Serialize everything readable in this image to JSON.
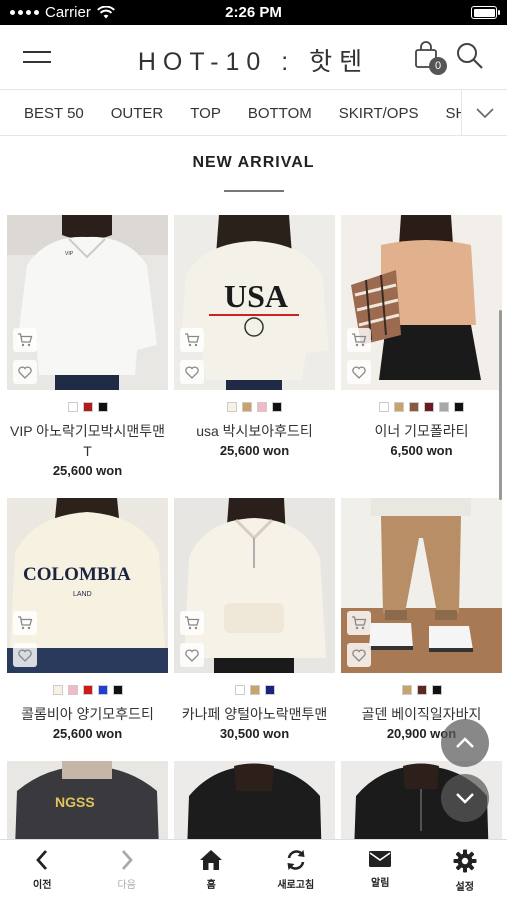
{
  "status_bar": {
    "carrier": "Carrier",
    "time": "2:26 PM"
  },
  "header": {
    "logo": "HOT-10 : 핫텐",
    "cart_count": "0"
  },
  "categories": [
    "BEST 50",
    "OUTER",
    "TOP",
    "BOTTOM",
    "SKIRT/OPS",
    "SHO"
  ],
  "section": {
    "title": "NEW ARRIVAL"
  },
  "products": [
    {
      "name": "VIP 아노락기모박시맨투맨T",
      "price": "25,600 won",
      "colors": [
        "#ffffff",
        "#b01c1c",
        "#111111"
      ]
    },
    {
      "name": "usa 박시보아후드티",
      "price": "25,600 won",
      "colors": [
        "#f7f2e3",
        "#c9a46a",
        "#f2b8c6",
        "#111111"
      ]
    },
    {
      "name": "이너 기모폴라티",
      "price": "6,500 won",
      "colors": [
        "#ffffff",
        "#c9a46a",
        "#8b5a3c",
        "#6a1a22",
        "#a8a8a8",
        "#111111"
      ]
    },
    {
      "name": "콜롬비아 양기모후드티",
      "price": "25,600 won",
      "colors": [
        "#f7f2e3",
        "#f2b8c6",
        "#cc1b1b",
        "#1f3fd0",
        "#111111"
      ]
    },
    {
      "name": "카나페 양털아노락맨투맨",
      "price": "30,500 won",
      "colors": [
        "#ffffff",
        "#c9a46a",
        "#1a237e"
      ]
    },
    {
      "name": "골덴 베이직일자바지",
      "price": "20,900 won",
      "colors": [
        "#c9a46a",
        "#5b2a1e",
        "#111111"
      ]
    }
  ],
  "bottom_nav": [
    {
      "label": "이전",
      "icon": "back-icon"
    },
    {
      "label": "다음",
      "icon": "forward-icon"
    },
    {
      "label": "홈",
      "icon": "home-icon"
    },
    {
      "label": "새로고침",
      "icon": "refresh-icon"
    },
    {
      "label": "알림",
      "icon": "mail-icon"
    },
    {
      "label": "설정",
      "icon": "gear-icon"
    }
  ]
}
